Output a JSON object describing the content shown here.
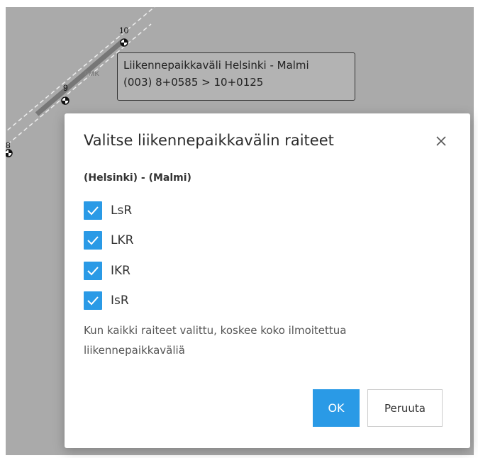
{
  "map": {
    "km_markers": [
      "8",
      "9",
      "10"
    ],
    "station_code": "PMK",
    "colors": {
      "background": "#aaaaaa",
      "track_highlight": "#777777",
      "track_dashed": "#eeeeee"
    }
  },
  "tooltip": {
    "line1": "Liikennepaikkaväli Helsinki - Malmi",
    "line2": "(003) 8+0585 > 10+0125"
  },
  "dialog": {
    "title": "Valitse liikennepaikkavälin raiteet",
    "close_icon": "close-icon",
    "section_label": "(Helsinki) - (Malmi)",
    "tracks": [
      {
        "label": "LsR",
        "checked": true
      },
      {
        "label": "LKR",
        "checked": true
      },
      {
        "label": "IKR",
        "checked": true
      },
      {
        "label": "IsR",
        "checked": true
      }
    ],
    "note": "Kun kaikki raiteet valittu, koskee koko ilmoitettua liikennepaikkaväliä",
    "ok_label": "OK",
    "cancel_label": "Peruuta",
    "colors": {
      "accent": "#2a9ae6"
    }
  }
}
